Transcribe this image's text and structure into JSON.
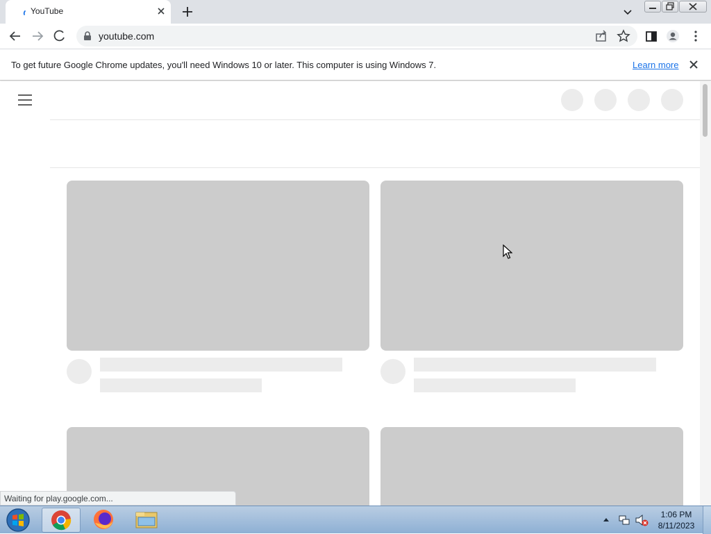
{
  "tab": {
    "title": "YouTube"
  },
  "omnibox": {
    "url": "youtube.com"
  },
  "infobar": {
    "message": "To get future Google Chrome updates, you'll need Windows 10 or later. This computer is using Windows 7.",
    "learn_more": "Learn more"
  },
  "status": {
    "text": "Waiting for play.google.com..."
  },
  "taskbar": {
    "apps": [
      "chrome-icon",
      "firefox-icon",
      "file-explorer-icon"
    ],
    "time": "1:06 PM",
    "date": "8/11/2023"
  },
  "colors": {
    "skeleton_dark": "#cccccc",
    "skeleton_light": "#ececec",
    "link": "#1a73e8",
    "tabstrip": "#dee1e6"
  }
}
